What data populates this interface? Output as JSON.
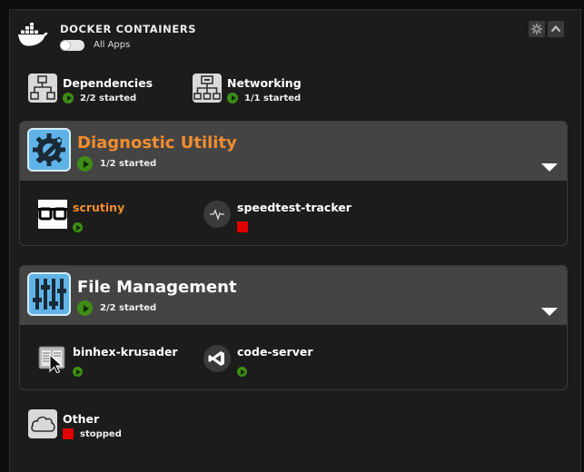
{
  "header": {
    "title": "DOCKER CONTAINERS",
    "toggle_label": "All Apps"
  },
  "colors": {
    "accent": "#f28d2f",
    "running": "#3f8d16",
    "stopped": "#e10000",
    "card_header": "#444444"
  },
  "groups_top": [
    {
      "name": "Dependencies",
      "status": "2/2 started",
      "state": "running",
      "icon": "sitemap-icon"
    },
    {
      "name": "Networking",
      "status": "1/1 started",
      "state": "running",
      "icon": "network-icon"
    }
  ],
  "cards": [
    {
      "title": "Diagnostic Utility",
      "status": "1/2 started",
      "icon": "gear-wrench-icon",
      "apps": [
        {
          "name": "scrutiny",
          "state": "running",
          "icon": "glasses-icon"
        },
        {
          "name": "speedtest-tracker",
          "state": "stopped",
          "icon": "pulse-icon"
        }
      ]
    },
    {
      "title": "File Management",
      "status": "2/2 started",
      "icon": "sliders-icon",
      "apps": [
        {
          "name": "binhex-krusader",
          "state": "running",
          "icon": "krusader-icon"
        },
        {
          "name": "code-server",
          "state": "running",
          "icon": "vscode-icon"
        }
      ]
    }
  ],
  "other": {
    "name": "Other",
    "status": "stopped",
    "state": "stopped",
    "icon": "cloud-icon"
  }
}
